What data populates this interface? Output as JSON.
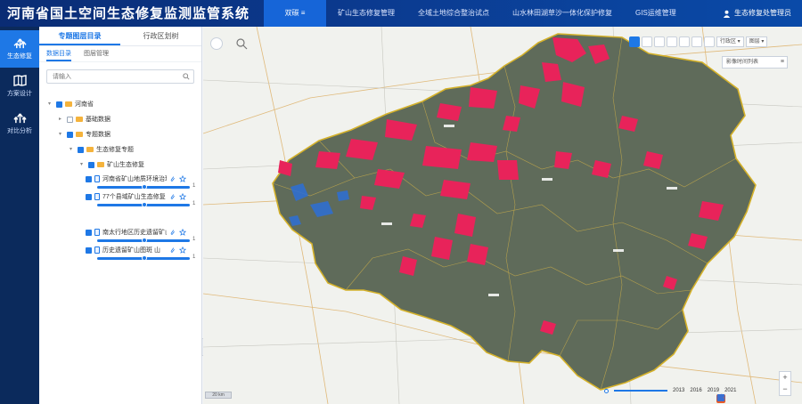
{
  "header": {
    "title": "河南省国土空间生态修复监测监管系统",
    "nav": [
      "双碳 ≡",
      "矿山生态修复管理",
      "全域土地综合整治试点",
      "山水林田湖草沙一体化保护修复",
      "GIS运维管理"
    ],
    "user": "生态修复处管理员"
  },
  "rail": [
    {
      "label": "生态修复",
      "icon": "ecology-icon"
    },
    {
      "label": "方案设计",
      "icon": "map-book-icon"
    },
    {
      "label": "对比分析",
      "icon": "analysis-icon"
    }
  ],
  "panel": {
    "tabs": [
      "专题图层目录",
      "行政区划树"
    ],
    "subtabs": [
      "数据目录",
      "图层管理"
    ],
    "search_placeholder": "请输入",
    "tree": {
      "root": "河南省",
      "base": "基础数据",
      "thematic": "专题数据",
      "eco": "生态修复专题",
      "mine": "矿山生态修复",
      "layers": [
        {
          "name": "河南省矿山地质环境治理",
          "value": "1"
        },
        {
          "name": "77个县域矿山生态修复",
          "value": "1"
        },
        {
          "name": "南太行地区历史遗留矿山",
          "value": "1"
        },
        {
          "name": "历史遗留矿山图斑 山",
          "value": "1"
        }
      ]
    }
  },
  "map": {
    "toolbar_select_1": "行政区 ▾",
    "toolbar_select_2": "图层 ▾",
    "time_label": "影像时间列表",
    "timeline_years": [
      "2013",
      "2016",
      "2019",
      "2021"
    ],
    "scale_text": "20 km",
    "colors": {
      "satellite": "#5f6b5a",
      "damage": "#e8235a",
      "water": "#2d6fd6",
      "border": "#d4b12a"
    }
  }
}
